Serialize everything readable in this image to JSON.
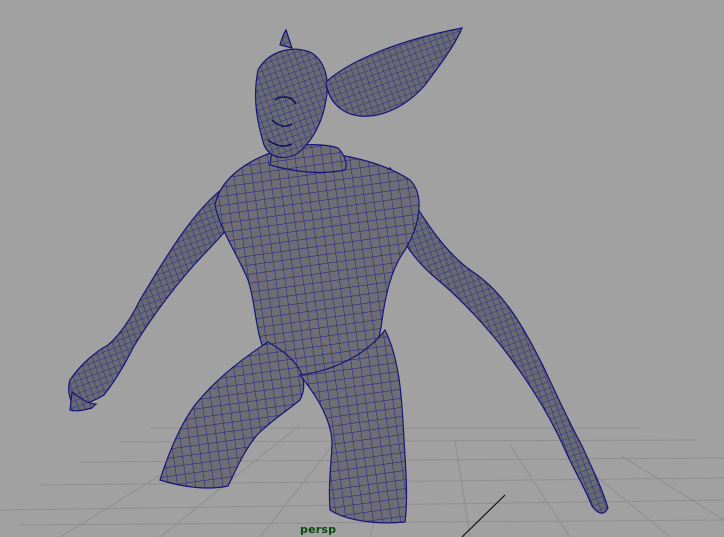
{
  "viewport": {
    "camera_name": "persp",
    "background_color": "#a1a1a1",
    "grid_color": "#8e8e8e",
    "grid_axis_color": "#111111",
    "mesh_fill_color": "#6e6e74",
    "mesh_wire_color": "#1c1c8e",
    "label_color": "#0a4a0a"
  }
}
